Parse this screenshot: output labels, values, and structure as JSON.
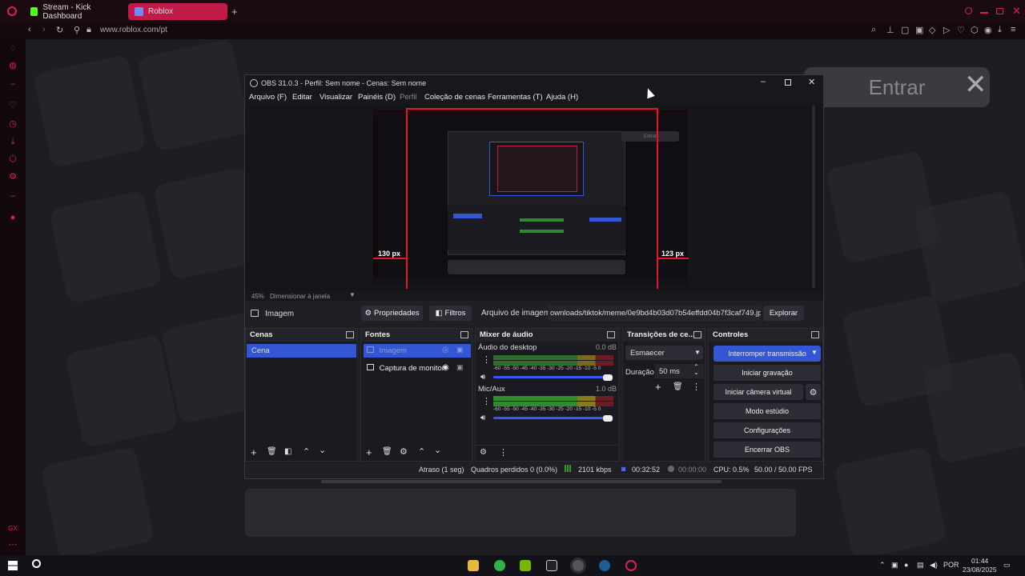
{
  "browser": {
    "tabs": [
      {
        "label": "Stream - Kick Dashboard",
        "color": "#53fc18"
      },
      {
        "label": "Roblox",
        "color": "#6b8cff",
        "active": true
      }
    ],
    "new_tab": "+",
    "url": "www.roblox.com/pt"
  },
  "page": {
    "login_button": "Entrar"
  },
  "obs": {
    "title": "OBS 31.0.3 - Perfil: Sem nome - Cenas: Sem nome",
    "menu": [
      "Arquivo (F)",
      "Editar",
      "Visualizar",
      "Painéis (D)",
      "Perfil",
      "Coleção de cenas",
      "Ferramentas (T)",
      "Ajuda (H)"
    ],
    "preview": {
      "left_px_label": "130 px",
      "right_px_label": "123 px",
      "zoom": "45%",
      "zoom_mode": "Dimensionar à janela"
    },
    "source_toolbar": {
      "source_name": "Imagem",
      "properties": "Propriedades",
      "filters": "Filtros",
      "image_file_label": "Arquivo de imagem",
      "image_path": "ownloads/tiktok/meme/0e9bd4b03d07b54effdd04b7f3caf749.jpg",
      "browse": "Explorar"
    },
    "scenes": {
      "title": "Cenas",
      "items": [
        "Cena"
      ]
    },
    "sources": {
      "title": "Fontes",
      "items": [
        "Imagem",
        "Captura de monitor"
      ]
    },
    "mixer": {
      "title": "Mixer de áudio",
      "channels": [
        {
          "name": "Áudio do desktop",
          "db": "0.0 dB",
          "scale": "-60 -55 -50 -45 -40 -35 -30 -25 -20 -15 -10 -5 0"
        },
        {
          "name": "Mic/Aux",
          "db": "1.0 dB",
          "scale": "-60 -55 -50 -45 -40 -35 -30 -25 -20 -15 -10 -5 0"
        }
      ]
    },
    "transitions": {
      "title": "Transições de ce...",
      "selected": "Esmaecer",
      "duration_label": "Duração",
      "duration_value": "50 ms"
    },
    "controls": {
      "title": "Controles",
      "buttons": [
        "Interromper transmissão",
        "Iniciar gravação",
        "Iniciar câmera virtual",
        "Modo estúdio",
        "Configurações",
        "Encerrar OBS"
      ]
    },
    "status": {
      "delay": "Atraso (1 seg)",
      "dropped": "Quadros perdidos 0 (0.0%)",
      "bitrate": "2101 kbps",
      "stream_time": "00:32:52",
      "rec_time": "00:00:00",
      "cpu": "CPU: 0.5%",
      "fps": "50.00 / 50.00 FPS"
    }
  },
  "taskbar": {
    "lang": "POR",
    "time": "01:44",
    "date": "23/08/2025"
  },
  "colors": {
    "accent_red": "#e0204a",
    "obs_blue": "#3256d4"
  }
}
